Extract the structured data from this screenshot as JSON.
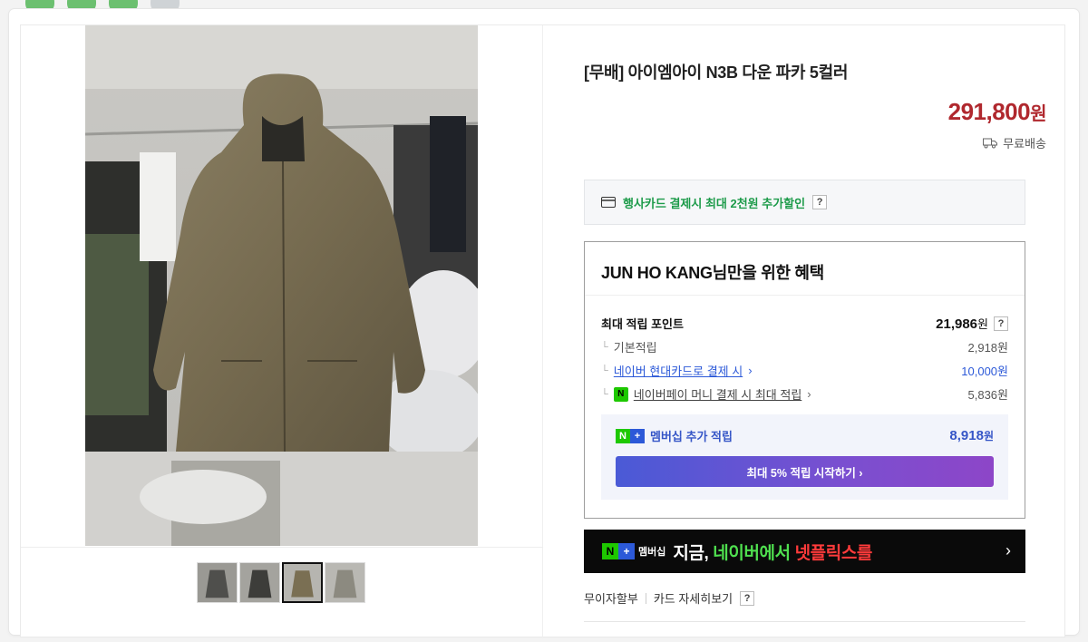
{
  "product": {
    "title": "[무배] 아이엠아이 N3B 다운 파카 5컬러",
    "price": "291,800",
    "price_unit": "원",
    "shipping": "무료배송"
  },
  "card_discount": {
    "text": "행사카드 결제시 최대 2천원 추가할인",
    "help": "?"
  },
  "benefit": {
    "title": "JUN HO KANG님만을 위한 혜택",
    "max_points_label": "최대 적립 포인트",
    "max_points_value": "21,986",
    "max_points_unit": "원",
    "help": "?",
    "rows": [
      {
        "label": "기본적립",
        "value": "2,918원"
      },
      {
        "label": "네이버 현대카드로 결제 시",
        "value": "10,000원"
      },
      {
        "label": "네이버페이 머니 결제 시 최대 적립",
        "value": "5,836원"
      }
    ],
    "member_label": "멤버십 추가 적립",
    "member_value": "8,918",
    "member_unit": "원",
    "cta": "최대 5% 적립 시작하기 ›"
  },
  "banner": {
    "badge_text": "멤버십",
    "msg_a": "지금, ",
    "msg_b": "네이버에서 ",
    "msg_c": "넷플릭스를"
  },
  "installment": {
    "label": "무이자할부",
    "link": "카드 자세히보기",
    "help": "?"
  },
  "colors": {
    "price": "#b0282e",
    "discount_green": "#1d9b4a",
    "link_blue": "#2c59d8"
  }
}
